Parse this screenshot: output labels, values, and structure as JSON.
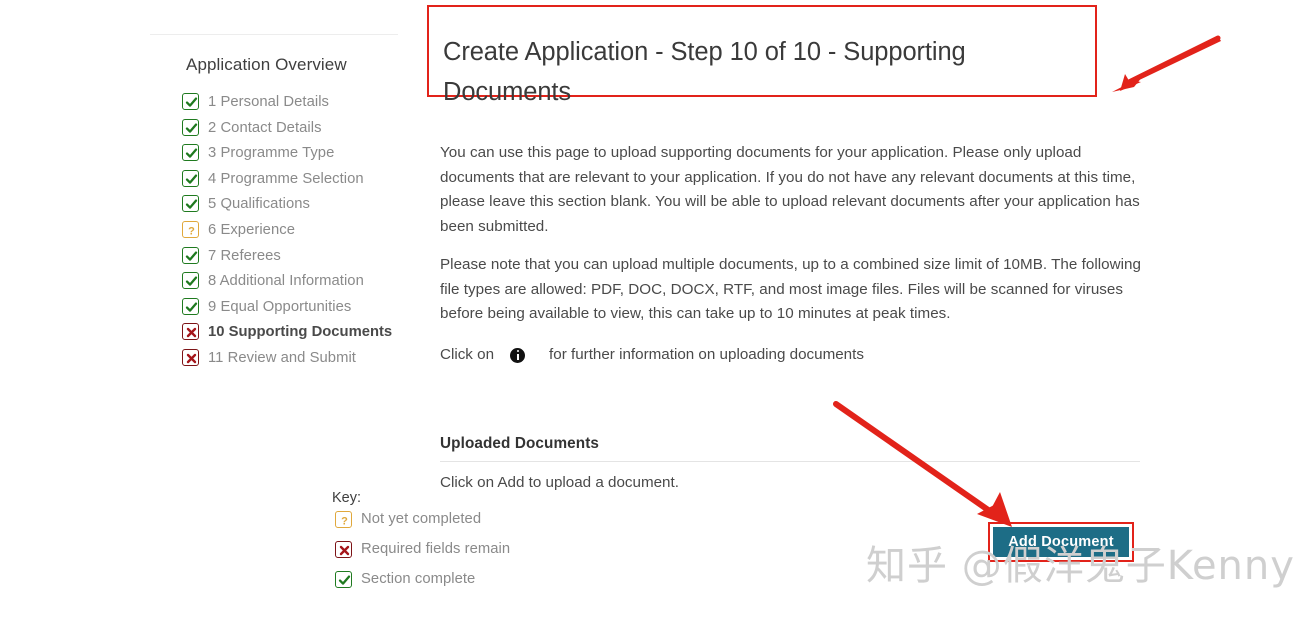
{
  "sidebar": {
    "overview_title": "Application Overview",
    "items": [
      {
        "label": "1 Personal Details",
        "status": "done"
      },
      {
        "label": "2 Contact Details",
        "status": "done"
      },
      {
        "label": "3 Programme Type",
        "status": "done"
      },
      {
        "label": "4 Programme Selection",
        "status": "done"
      },
      {
        "label": "5 Qualifications",
        "status": "done"
      },
      {
        "label": "6 Experience",
        "status": "todo"
      },
      {
        "label": "7 Referees",
        "status": "done"
      },
      {
        "label": "8 Additional Information",
        "status": "done"
      },
      {
        "label": "9 Equal Opportunities",
        "status": "done"
      },
      {
        "label": "10 Supporting Documents",
        "status": "missing",
        "current": true
      },
      {
        "label": "11 Review and Submit",
        "status": "missing"
      }
    ],
    "key_title": "Key:",
    "key": [
      {
        "label": "Not yet completed",
        "status": "todo"
      },
      {
        "label": "Required fields remain",
        "status": "missing"
      },
      {
        "label": "Section complete",
        "status": "done"
      }
    ]
  },
  "main": {
    "page_title": "Create Application - Step 10 of 10 - Supporting Documents",
    "paragraph_1": "You can use this page to upload supporting documents for your application. Please only upload documents that are relevant to your application. If you do not have any relevant documents at this time, please leave this section blank. You will be able to upload relevant documents after your application has been submitted.",
    "paragraph_2": "Please note that you can upload multiple documents, up to a combined size limit of 10MB. The following file types are allowed: PDF, DOC, DOCX, RTF, and most image files. Files will be scanned for viruses before being available to view, this can take up to 10 minutes at peak times.",
    "info_line_prefix": "Click on",
    "info_icon_name": "info-icon",
    "info_line_suffix": "for further information on uploading documents",
    "uploaded_heading": "Uploaded Documents",
    "uploaded_hint": "Click on Add to upload a document.",
    "add_document_label": "Add Document"
  },
  "annotations": {
    "arrow_color": "#e2231a",
    "highlight_color": "#e2231a",
    "watermark": "知乎 @假洋鬼子Kenny"
  },
  "colors": {
    "status_done": "#1f7a1f",
    "status_todo": "#e0a83c",
    "status_missing": "#7d1316",
    "button_background": "#1d6d86",
    "annotation_red": "#e2231a",
    "text_muted": "#8a8a8a",
    "text_body": "#4a4a4a"
  }
}
